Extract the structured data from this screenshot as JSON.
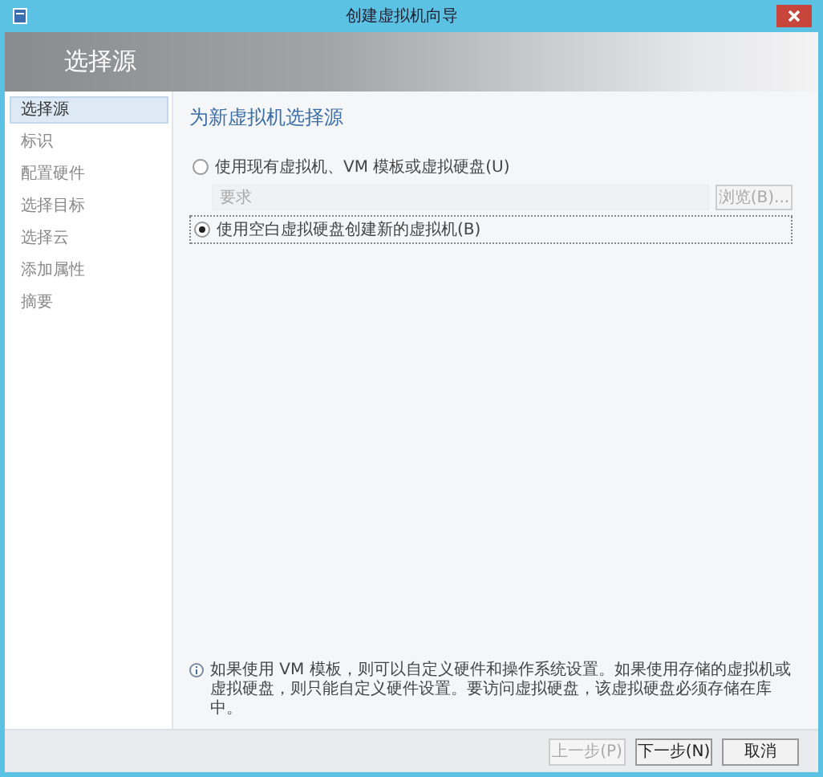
{
  "window": {
    "title": "创建虚拟机向导"
  },
  "header": {
    "title": "选择源"
  },
  "sidebar": {
    "items": [
      {
        "label": "选择源",
        "selected": true
      },
      {
        "label": "标识",
        "selected": false
      },
      {
        "label": "配置硬件",
        "selected": false
      },
      {
        "label": "选择目标",
        "selected": false
      },
      {
        "label": "选择云",
        "selected": false
      },
      {
        "label": "添加属性",
        "selected": false
      },
      {
        "label": "摘要",
        "selected": false
      }
    ]
  },
  "main": {
    "heading": "为新虚拟机选择源",
    "options": [
      {
        "label": "使用现有虚拟机、VM 模板或虚拟硬盘(U)",
        "selected": false
      },
      {
        "label": "使用空白虚拟硬盘创建新的虚拟机(B)",
        "selected": true
      }
    ],
    "path_field": {
      "placeholder": "要求",
      "disabled": true
    },
    "browse_button": {
      "label": "浏览(B)...",
      "disabled": true
    },
    "info": "如果使用 VM 模板，则可以自定义硬件和操作系统设置。如果使用存储的虚拟机或虚拟硬盘，则只能自定义硬件设置。要访问虚拟硬盘，该虚拟硬盘必须存储在库中。"
  },
  "buttons": [
    {
      "label": "上一步(P)",
      "disabled": true
    },
    {
      "label": "下一步(N)",
      "disabled": false
    },
    {
      "label": "取消",
      "disabled": false
    }
  ]
}
